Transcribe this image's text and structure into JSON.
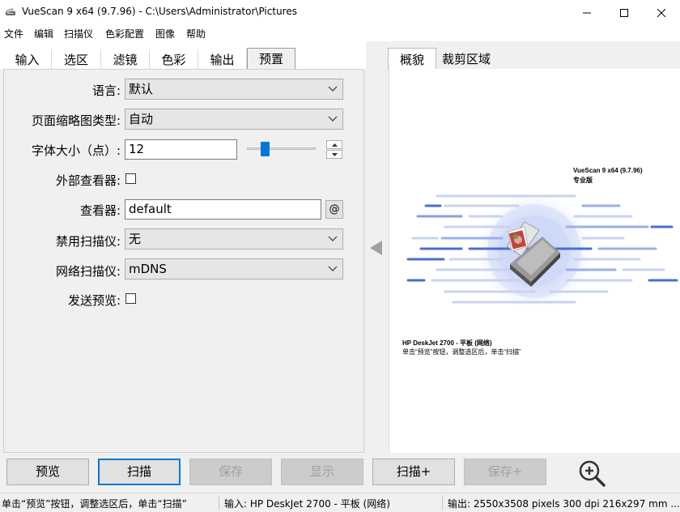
{
  "window": {
    "title": "VueScan 9 x64 (9.7.96) - C:\\Users\\Administrator\\Pictures",
    "controls": [
      "minimize-icon",
      "maximize-icon",
      "close-icon"
    ]
  },
  "menu": [
    "文件",
    "编辑",
    "扫描仪",
    "色彩配置",
    "图像",
    "帮助"
  ],
  "left_tabs": [
    {
      "label": "输入",
      "active": false
    },
    {
      "label": "选区",
      "active": false
    },
    {
      "label": "滤镜",
      "active": false
    },
    {
      "label": "色彩",
      "active": false
    },
    {
      "label": "输出",
      "active": false
    },
    {
      "label": "预置",
      "active": true
    }
  ],
  "settings": {
    "language": {
      "label": "语言:",
      "value": "默认"
    },
    "thumbnail_type": {
      "label": "页面缩略图类型:",
      "value": "自动"
    },
    "font_size": {
      "label": "字体大小（点）:",
      "value": "12"
    },
    "external_viewer": {
      "label": "外部查看器:",
      "checked": false
    },
    "viewer": {
      "label": "查看器:",
      "value": "default",
      "button": "@"
    },
    "disable_scanner": {
      "label": "禁用扫描仪:",
      "value": "无"
    },
    "network_scanner": {
      "label": "网络扫描仪:",
      "value": "mDNS"
    },
    "send_preview": {
      "label": "发送预览:",
      "checked": false
    }
  },
  "right_tabs": [
    {
      "label": "概貌",
      "active": true
    },
    {
      "label": "裁剪区域",
      "active": false
    }
  ],
  "preview": {
    "product_title": "VueScan 9 x64 (9.7.96)",
    "edition": "专业版",
    "scanner_line": "HP DeskJet 2700 - 平板 (网络)",
    "hint_line": "单击“预览”按钮，调整选区后，单击“扫描”"
  },
  "buttons": [
    {
      "label": "预览",
      "enabled": true,
      "default": false
    },
    {
      "label": "扫描",
      "enabled": true,
      "default": true
    },
    {
      "label": "保存",
      "enabled": false,
      "default": false
    },
    {
      "label": "显示",
      "enabled": false,
      "default": false
    },
    {
      "label": "扫描+",
      "enabled": true,
      "default": false
    },
    {
      "label": "保存+",
      "enabled": false,
      "default": false
    }
  ],
  "status": {
    "hint": "单击“预览”按钮，调整选区后，单击“扫描”",
    "input": "输入: HP DeskJet 2700 - 平板 (网络)",
    "output": "输出: 2550x3508 pixels 300 dpi 216x297 mm ..."
  },
  "colors": {
    "accent": "#0078d7",
    "preview_lines": "#4a6fd0"
  }
}
